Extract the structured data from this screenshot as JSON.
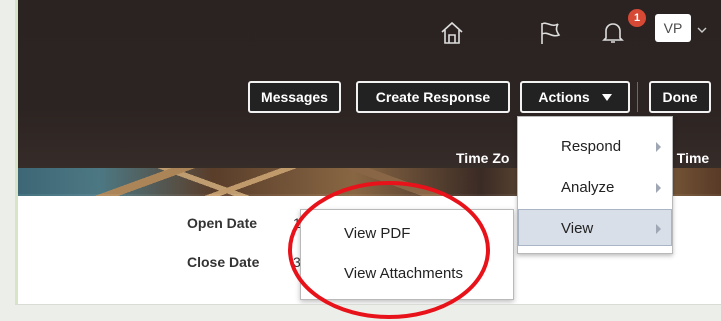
{
  "header": {
    "notification_count": "1",
    "user_initials": "VP",
    "icons": [
      "home-icon",
      "flag-icon",
      "notification-bell-icon",
      "chevron-down-icon"
    ]
  },
  "toolbar": {
    "messages_label": "Messages",
    "create_response_label": "Create Response",
    "actions_label": "Actions",
    "done_label": "Done"
  },
  "banner": {
    "left_text": "Time Zo",
    "right_text": "l Time"
  },
  "actions_menu": {
    "items": [
      {
        "label": "Respond"
      },
      {
        "label": "Analyze"
      },
      {
        "label": "View"
      }
    ],
    "active_item": "View"
  },
  "view_submenu": {
    "items": [
      {
        "label": "View PDF"
      },
      {
        "label": "View Attachments"
      }
    ]
  },
  "details": {
    "open_date_label": "Open Date",
    "open_date_value": "1",
    "close_date_label": "Close Date",
    "close_date_value": "3"
  },
  "colors": {
    "header_bg": "#2b2321",
    "button_border": "#f2f2f2",
    "highlight_bg": "#d9dfe8",
    "annotation_red": "#e8121a",
    "badge": "#d64a35"
  }
}
